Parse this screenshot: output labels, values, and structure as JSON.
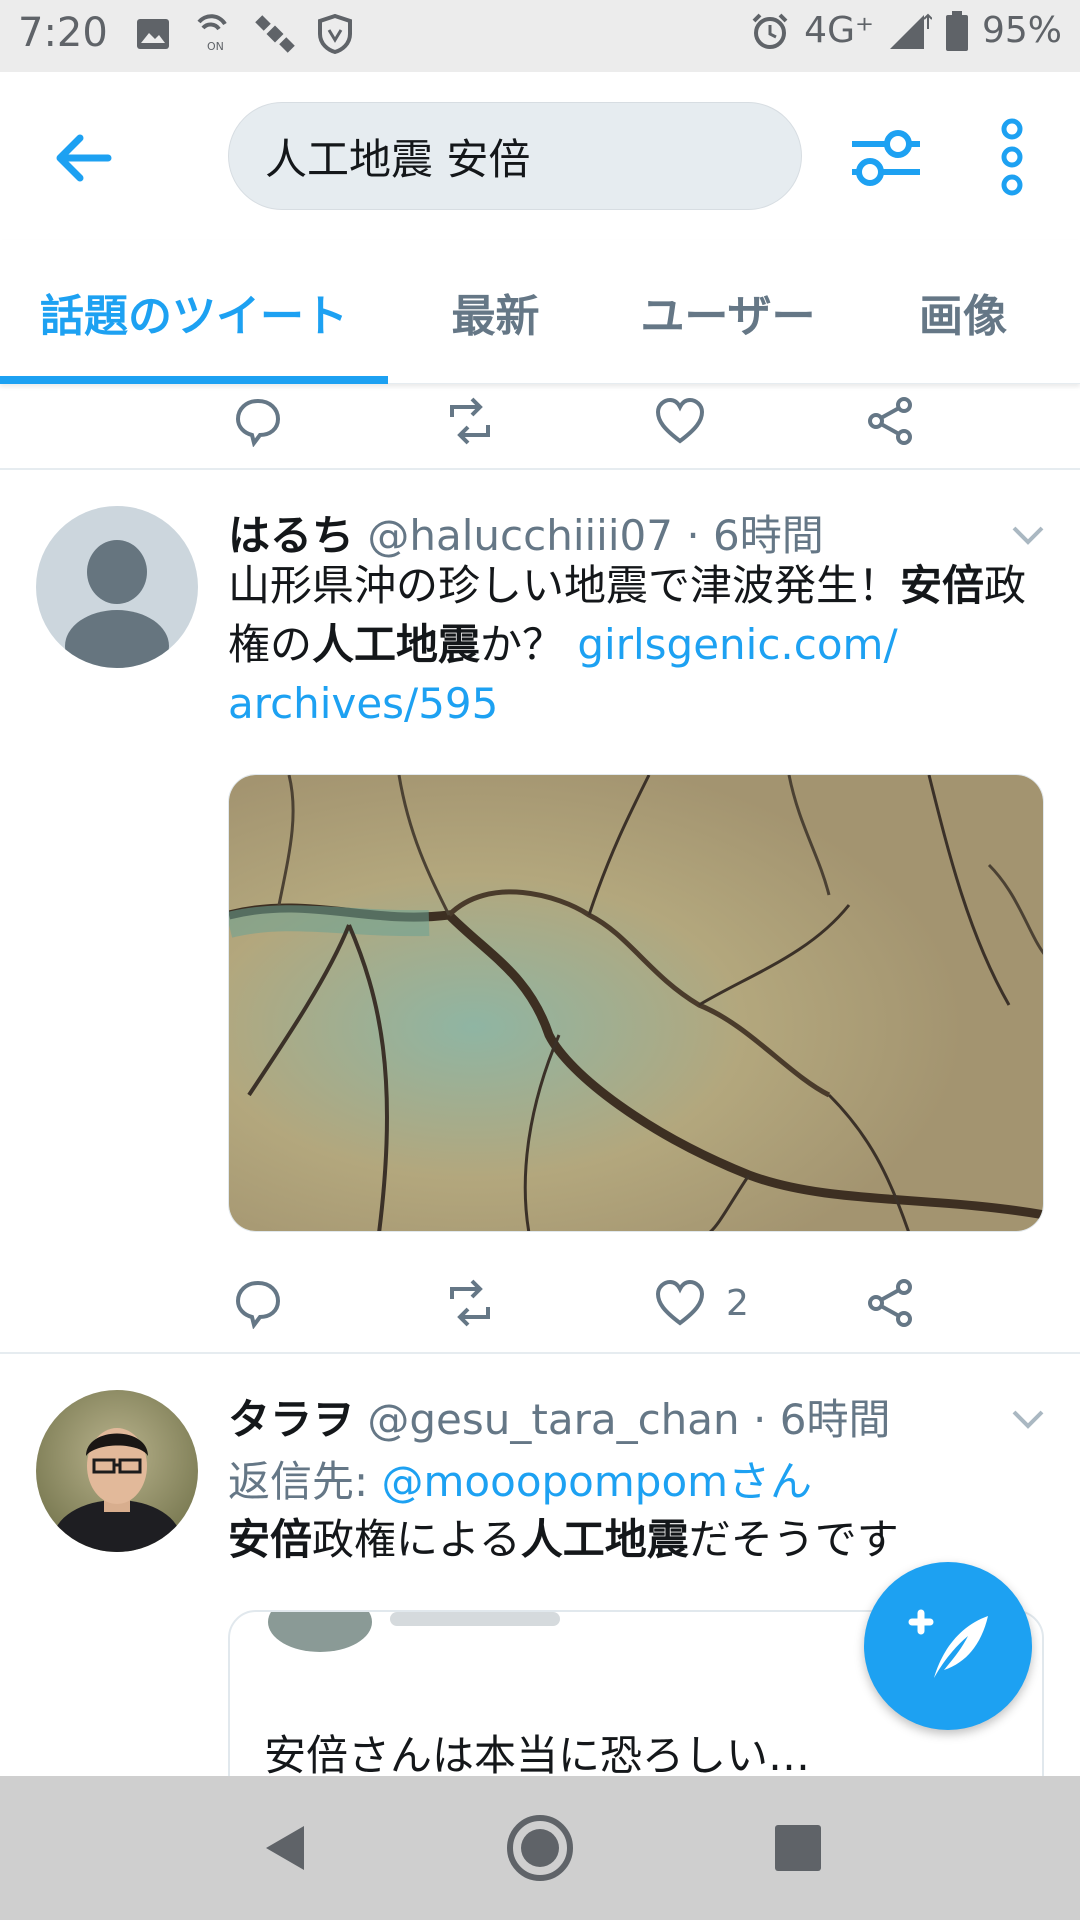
{
  "status_bar": {
    "time": "7:20",
    "network": "4G⁺",
    "battery": "95%",
    "left_icons": [
      "image-icon",
      "nfc-icon",
      "satellite-icon",
      "shield-icon"
    ],
    "right_icons": [
      "alarm-icon",
      "signal-icon",
      "battery-icon"
    ]
  },
  "search": {
    "query": "人工地震 安倍"
  },
  "tabs": [
    {
      "label": "話題のツイート",
      "active": true
    },
    {
      "label": "最新",
      "active": false
    },
    {
      "label": "ユーザー",
      "active": false
    },
    {
      "label": "画像",
      "active": false
    }
  ],
  "tweets": [
    {
      "name": "はるち",
      "handle": "@halucchiiii07",
      "time": "· 6時間",
      "text_parts": [
        "山形県沖の珍しい地震で津波発生！",
        "安倍",
        "政権の",
        "人工地震",
        "か？ "
      ],
      "link": "girlsgenic.com/archives/595",
      "link_line1": "girlsgenic.com/",
      "link_line2": "archives/595",
      "media": "cracked-ground-image",
      "likes": "2"
    },
    {
      "name": "タラヲ",
      "handle": "@gesu_tara_chan",
      "time": "· 6時間",
      "reply_label": "返信先: ",
      "reply_to": "@mooopompomさん",
      "text_parts": [
        "安倍",
        "政権による",
        "人工地震",
        "だそうです"
      ],
      "quote_text": "安倍さんは本当に恐ろしい…"
    }
  ],
  "colors": {
    "accent": "#1da1f2",
    "muted": "#657786",
    "text": "#14171a",
    "search_bg": "#e6ecf0",
    "status_bg": "#ececec",
    "nav_bg": "#cfcfcf"
  }
}
